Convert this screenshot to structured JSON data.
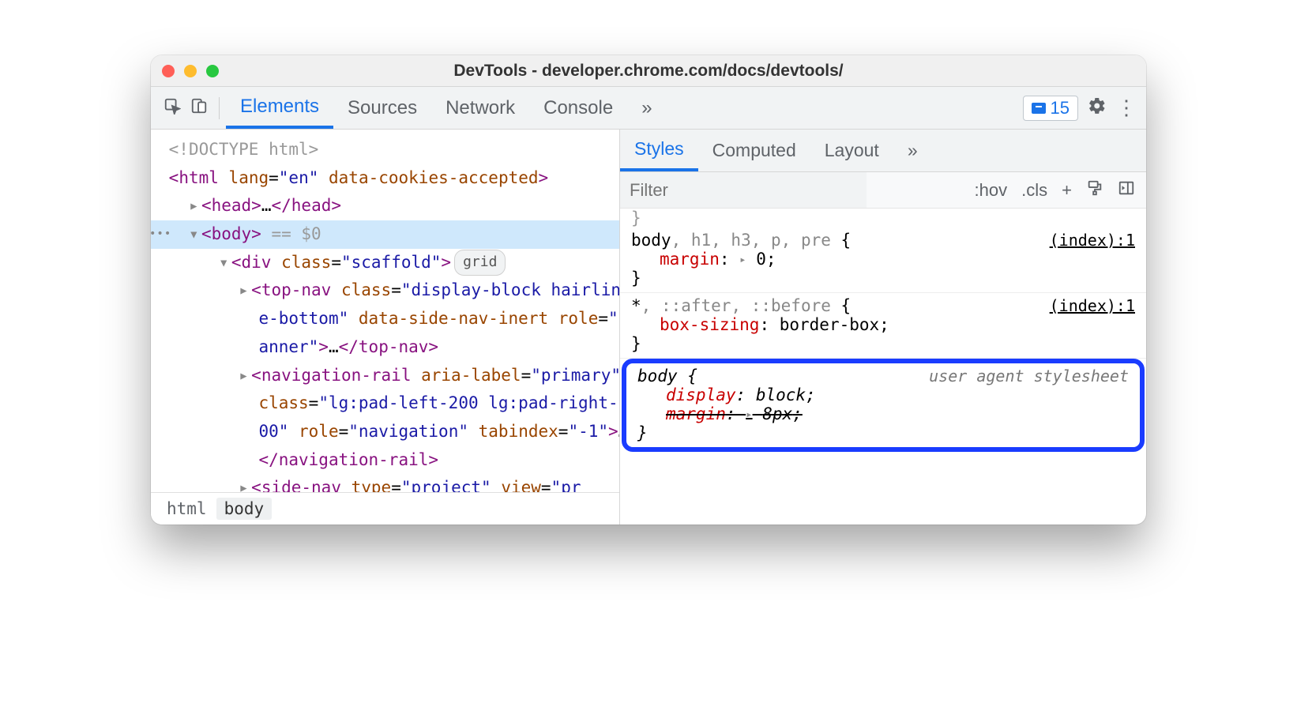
{
  "window": {
    "title": "DevTools - developer.chrome.com/docs/devtools/"
  },
  "tabs": {
    "items": [
      "Elements",
      "Sources",
      "Network",
      "Console"
    ],
    "active": "Elements",
    "more": "»",
    "issues_count": "15"
  },
  "dom": {
    "doctype": "<!DOCTYPE html>",
    "html_open": {
      "tag": "html",
      "attrs_text": "lang=\"en\" data-cookies-accepted"
    },
    "head": {
      "tag": "head",
      "ellipsis": "…"
    },
    "body_line": {
      "tag": "body",
      "suffix": " == $0"
    },
    "scaffold": {
      "tag": "div",
      "attr": "class=\"scaffold\"",
      "badge": "grid"
    },
    "topnav_lines": "<top-nav class=\"display-block hairline-bottom\" data-side-nav-inert role=\"banner\">…</top-nav>",
    "navrail_lines": "<navigation-rail aria-label=\"primary\" class=\"lg:pad-left-200 lg:pad-right-200\" role=\"navigation\" tabindex=\"-1\">…</navigation-rail>",
    "sidenav_partial": "<side-nav type=\"project\" view=\"pr"
  },
  "breadcrumb": {
    "items": [
      "html",
      "body"
    ],
    "active": "body"
  },
  "styles": {
    "tabs": [
      "Styles",
      "Computed",
      "Layout"
    ],
    "tabs_more": "»",
    "filter_placeholder": "Filter",
    "tools": {
      "hov": ":hov",
      "cls": ".cls",
      "plus": "+"
    },
    "leading_brace": "}",
    "rules": [
      {
        "selector": "body, h1, h3, p, pre {",
        "selector_dim_from": 1,
        "source": "(index):1",
        "decls": [
          {
            "prop": "margin",
            "tri": true,
            "val": "0"
          }
        ],
        "close": "}"
      },
      {
        "selector": "*, ::after, ::before {",
        "selector_dim_from": 1,
        "source": "(index):1",
        "decls": [
          {
            "prop": "box-sizing",
            "val": "border-box"
          }
        ],
        "close": "}"
      },
      {
        "ua": true,
        "selector": "body {",
        "source_label": "user agent stylesheet",
        "decls": [
          {
            "prop": "display",
            "val": "block"
          },
          {
            "prop": "margin",
            "tri": true,
            "val": "8px",
            "strike": true
          }
        ],
        "close": "}"
      }
    ]
  }
}
